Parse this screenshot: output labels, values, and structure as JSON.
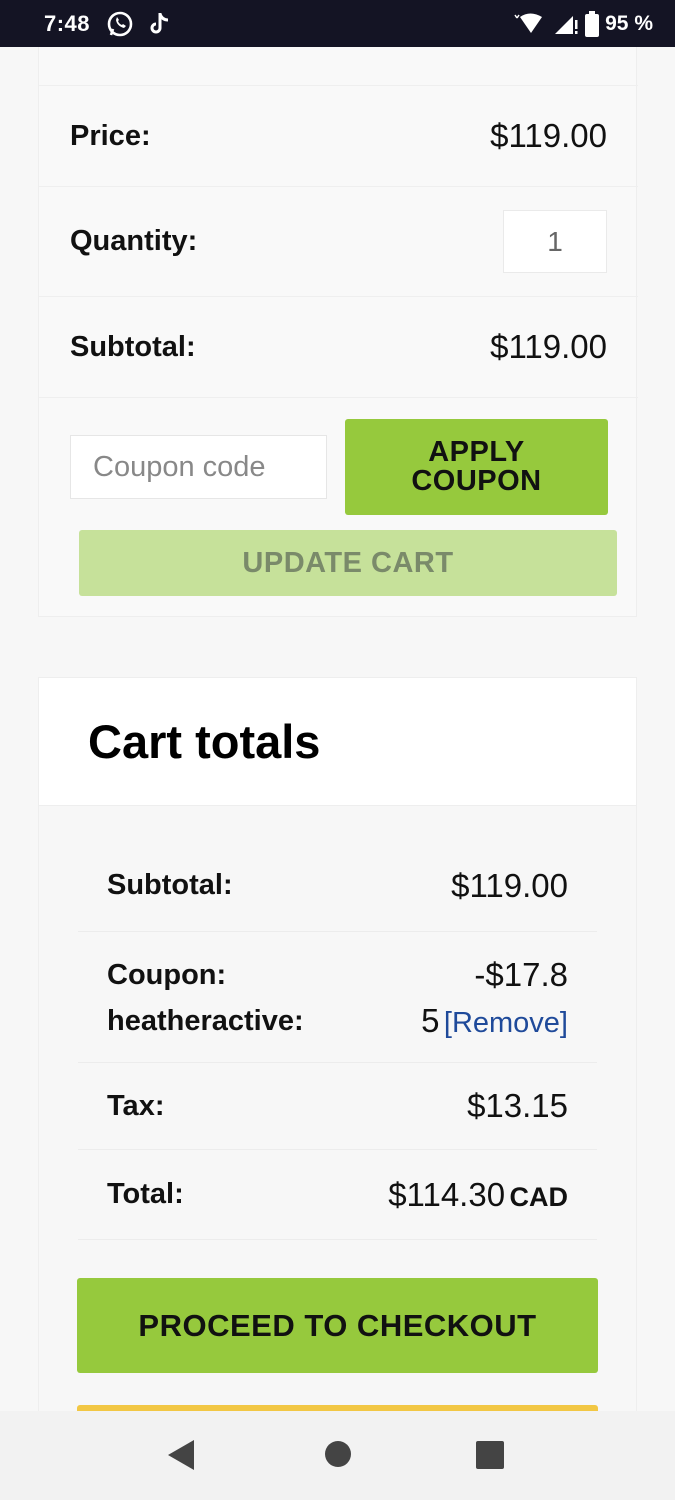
{
  "status_bar": {
    "time": "7:48",
    "battery": "95 %",
    "icons": [
      "whatsapp-icon",
      "tiktok-icon",
      "wifi-icon",
      "signal-icon",
      "battery-icon"
    ]
  },
  "cart_item": {
    "price_label": "Price:",
    "price_value": "$119.00",
    "quantity_label": "Quantity:",
    "quantity_value": "1",
    "subtotal_label": "Subtotal:",
    "subtotal_value": "$119.00"
  },
  "coupon": {
    "placeholder": "Coupon code",
    "apply_label_line1": "APPLY",
    "apply_label_line2": "COUPON",
    "update_label": "UPDATE CART"
  },
  "cart_totals": {
    "title": "Cart totals",
    "subtotal_label": "Subtotal:",
    "subtotal_value": "$119.00",
    "coupon_label": "Coupon: heatheractive:",
    "coupon_value_line1": "-$17.8",
    "coupon_value_line2": "5",
    "remove_label": "[Remove]",
    "tax_label": "Tax:",
    "tax_value": "$13.15",
    "total_label": "Total:",
    "total_value": "$114.30",
    "total_currency": "CAD"
  },
  "checkout": {
    "label": "PROCEED TO CHECKOUT"
  },
  "colors": {
    "accent_green": "#96c93d",
    "disabled_green": "#c6e19a",
    "link_blue": "#1f4a9a",
    "status_bar": "#141424"
  }
}
